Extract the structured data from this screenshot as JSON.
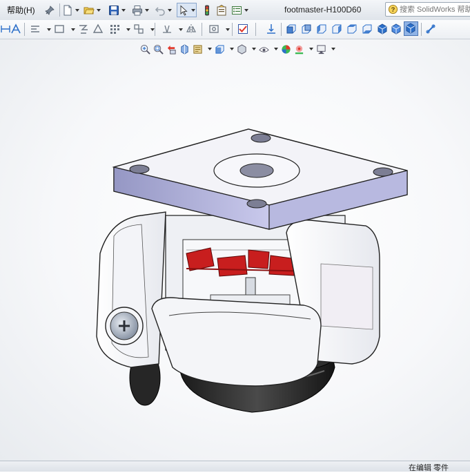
{
  "menu": {
    "help_label": "帮助(H)"
  },
  "document": {
    "title": "footmaster-H100D60"
  },
  "search": {
    "placeholder": "搜索 SolidWorks 帮助"
  },
  "status": {
    "mode_text": "在编辑 零件"
  },
  "colors": {
    "accent": "#2c6fc9",
    "selected_view": "#8fb3e6",
    "model_body": "#eef0f4",
    "model_plate_side": "#b8b9e0",
    "lock_red": "#c81e1e",
    "model_base": "#2a2a2a"
  },
  "icons": [
    "pin-icon",
    "new-document-icon",
    "open-folder-icon",
    "save-icon",
    "print-icon",
    "undo-icon",
    "select-pointer-icon",
    "rebuild-icon",
    "file-properties-icon",
    "options-icon",
    "search-icon",
    "zoom-to-fit-icon",
    "zoom-to-area-icon",
    "previous-view-icon",
    "section-view-icon",
    "view-orientation-icon",
    "display-style-icon",
    "hide-show-items-icon",
    "edit-appearance-icon",
    "apply-scene-icon",
    "view-settings-icon"
  ]
}
